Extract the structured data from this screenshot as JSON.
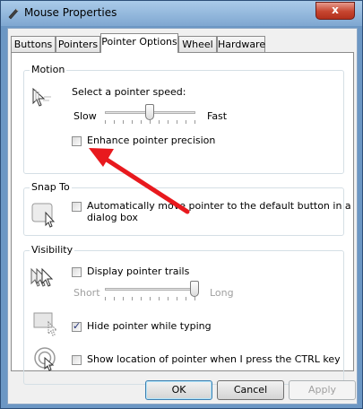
{
  "window": {
    "title": "Mouse Properties",
    "close_glyph": "x"
  },
  "tabs": [
    {
      "label": "Buttons"
    },
    {
      "label": "Pointers"
    },
    {
      "label": "Pointer Options"
    },
    {
      "label": "Wheel"
    },
    {
      "label": "Hardware"
    }
  ],
  "motion": {
    "group_label": "Motion",
    "speed_prompt": "Select a pointer speed:",
    "slow_label": "Slow",
    "fast_label": "Fast",
    "speed_level": 0.5,
    "enhance_label": "Enhance pointer precision",
    "enhance_checked": false
  },
  "snap_to": {
    "group_label": "Snap To",
    "label_line1": "Automatically move pointer to the default button in a",
    "label_line2": "dialog box",
    "checked": false
  },
  "visibility": {
    "group_label": "Visibility",
    "trails_label": "Display pointer trails",
    "trails_checked": false,
    "short_label": "Short",
    "long_label": "Long",
    "trail_level": 1.0,
    "hide_label": "Hide pointer while typing",
    "hide_checked": true,
    "ctrl_label": "Show location of pointer when I press the CTRL key",
    "ctrl_checked": false
  },
  "buttons": {
    "ok": "OK",
    "cancel": "Cancel",
    "apply": "Apply"
  },
  "annotation": {
    "arrow_color": "#e8191e"
  }
}
